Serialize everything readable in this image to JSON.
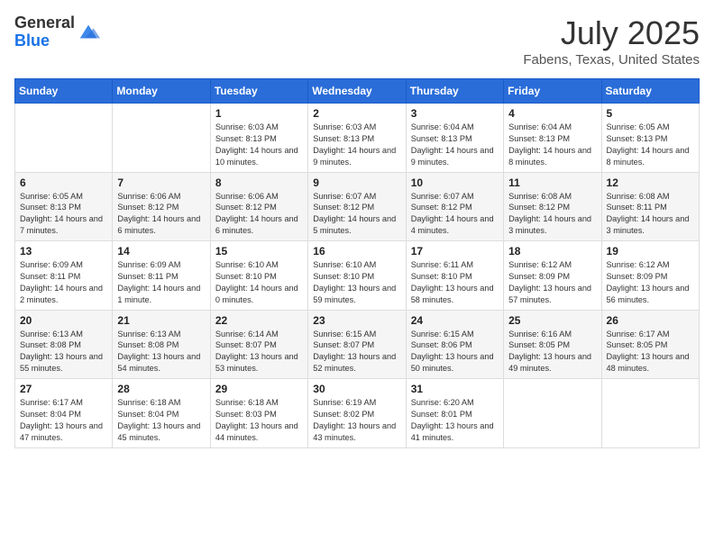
{
  "header": {
    "logo_line1": "General",
    "logo_line2": "Blue",
    "month_title": "July 2025",
    "location": "Fabens, Texas, United States"
  },
  "days_of_week": [
    "Sunday",
    "Monday",
    "Tuesday",
    "Wednesday",
    "Thursday",
    "Friday",
    "Saturday"
  ],
  "weeks": [
    [
      {
        "day": "",
        "content": ""
      },
      {
        "day": "",
        "content": ""
      },
      {
        "day": "1",
        "content": "Sunrise: 6:03 AM\nSunset: 8:13 PM\nDaylight: 14 hours and 10 minutes."
      },
      {
        "day": "2",
        "content": "Sunrise: 6:03 AM\nSunset: 8:13 PM\nDaylight: 14 hours and 9 minutes."
      },
      {
        "day": "3",
        "content": "Sunrise: 6:04 AM\nSunset: 8:13 PM\nDaylight: 14 hours and 9 minutes."
      },
      {
        "day": "4",
        "content": "Sunrise: 6:04 AM\nSunset: 8:13 PM\nDaylight: 14 hours and 8 minutes."
      },
      {
        "day": "5",
        "content": "Sunrise: 6:05 AM\nSunset: 8:13 PM\nDaylight: 14 hours and 8 minutes."
      }
    ],
    [
      {
        "day": "6",
        "content": "Sunrise: 6:05 AM\nSunset: 8:13 PM\nDaylight: 14 hours and 7 minutes."
      },
      {
        "day": "7",
        "content": "Sunrise: 6:06 AM\nSunset: 8:12 PM\nDaylight: 14 hours and 6 minutes."
      },
      {
        "day": "8",
        "content": "Sunrise: 6:06 AM\nSunset: 8:12 PM\nDaylight: 14 hours and 6 minutes."
      },
      {
        "day": "9",
        "content": "Sunrise: 6:07 AM\nSunset: 8:12 PM\nDaylight: 14 hours and 5 minutes."
      },
      {
        "day": "10",
        "content": "Sunrise: 6:07 AM\nSunset: 8:12 PM\nDaylight: 14 hours and 4 minutes."
      },
      {
        "day": "11",
        "content": "Sunrise: 6:08 AM\nSunset: 8:12 PM\nDaylight: 14 hours and 3 minutes."
      },
      {
        "day": "12",
        "content": "Sunrise: 6:08 AM\nSunset: 8:11 PM\nDaylight: 14 hours and 3 minutes."
      }
    ],
    [
      {
        "day": "13",
        "content": "Sunrise: 6:09 AM\nSunset: 8:11 PM\nDaylight: 14 hours and 2 minutes."
      },
      {
        "day": "14",
        "content": "Sunrise: 6:09 AM\nSunset: 8:11 PM\nDaylight: 14 hours and 1 minute."
      },
      {
        "day": "15",
        "content": "Sunrise: 6:10 AM\nSunset: 8:10 PM\nDaylight: 14 hours and 0 minutes."
      },
      {
        "day": "16",
        "content": "Sunrise: 6:10 AM\nSunset: 8:10 PM\nDaylight: 13 hours and 59 minutes."
      },
      {
        "day": "17",
        "content": "Sunrise: 6:11 AM\nSunset: 8:10 PM\nDaylight: 13 hours and 58 minutes."
      },
      {
        "day": "18",
        "content": "Sunrise: 6:12 AM\nSunset: 8:09 PM\nDaylight: 13 hours and 57 minutes."
      },
      {
        "day": "19",
        "content": "Sunrise: 6:12 AM\nSunset: 8:09 PM\nDaylight: 13 hours and 56 minutes."
      }
    ],
    [
      {
        "day": "20",
        "content": "Sunrise: 6:13 AM\nSunset: 8:08 PM\nDaylight: 13 hours and 55 minutes."
      },
      {
        "day": "21",
        "content": "Sunrise: 6:13 AM\nSunset: 8:08 PM\nDaylight: 13 hours and 54 minutes."
      },
      {
        "day": "22",
        "content": "Sunrise: 6:14 AM\nSunset: 8:07 PM\nDaylight: 13 hours and 53 minutes."
      },
      {
        "day": "23",
        "content": "Sunrise: 6:15 AM\nSunset: 8:07 PM\nDaylight: 13 hours and 52 minutes."
      },
      {
        "day": "24",
        "content": "Sunrise: 6:15 AM\nSunset: 8:06 PM\nDaylight: 13 hours and 50 minutes."
      },
      {
        "day": "25",
        "content": "Sunrise: 6:16 AM\nSunset: 8:05 PM\nDaylight: 13 hours and 49 minutes."
      },
      {
        "day": "26",
        "content": "Sunrise: 6:17 AM\nSunset: 8:05 PM\nDaylight: 13 hours and 48 minutes."
      }
    ],
    [
      {
        "day": "27",
        "content": "Sunrise: 6:17 AM\nSunset: 8:04 PM\nDaylight: 13 hours and 47 minutes."
      },
      {
        "day": "28",
        "content": "Sunrise: 6:18 AM\nSunset: 8:04 PM\nDaylight: 13 hours and 45 minutes."
      },
      {
        "day": "29",
        "content": "Sunrise: 6:18 AM\nSunset: 8:03 PM\nDaylight: 13 hours and 44 minutes."
      },
      {
        "day": "30",
        "content": "Sunrise: 6:19 AM\nSunset: 8:02 PM\nDaylight: 13 hours and 43 minutes."
      },
      {
        "day": "31",
        "content": "Sunrise: 6:20 AM\nSunset: 8:01 PM\nDaylight: 13 hours and 41 minutes."
      },
      {
        "day": "",
        "content": ""
      },
      {
        "day": "",
        "content": ""
      }
    ]
  ]
}
